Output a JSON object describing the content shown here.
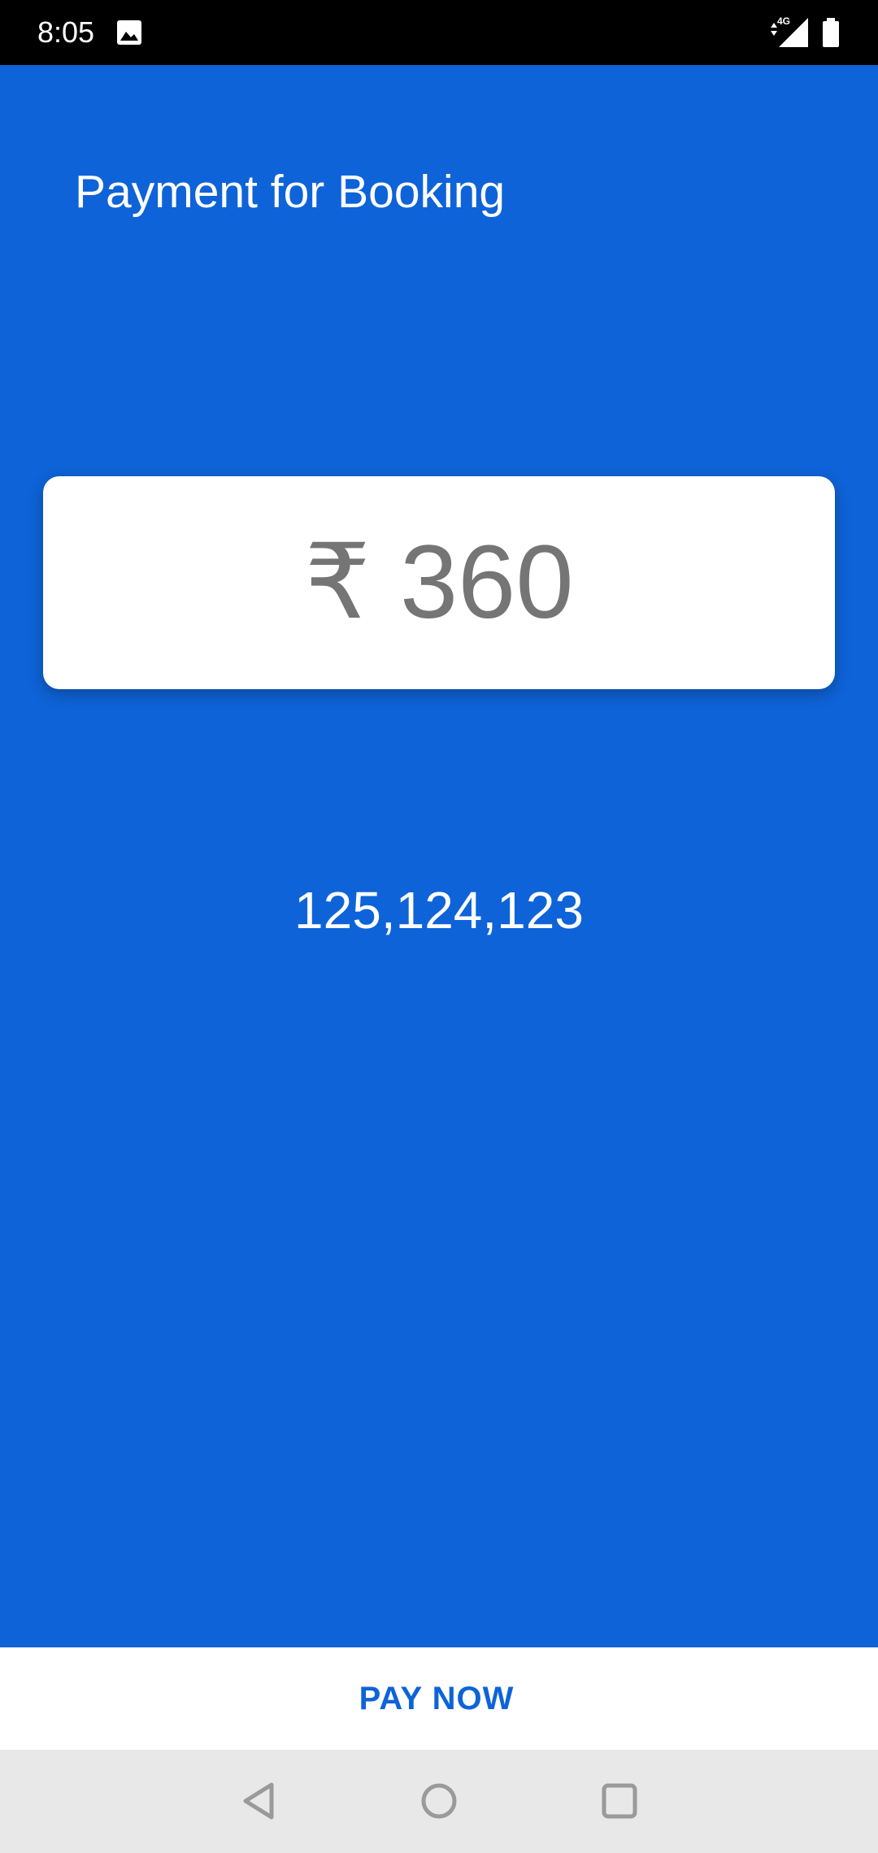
{
  "status_bar": {
    "time": "8:05",
    "network": "4G",
    "icons": [
      "image-icon",
      "signal-icon",
      "battery-icon"
    ]
  },
  "page": {
    "title": "Payment for Booking",
    "background_color": "#0E63D8"
  },
  "amount_card": {
    "currency_symbol": "₹",
    "amount": "360"
  },
  "booking": {
    "ids": "125,124,123"
  },
  "pay_button": {
    "label": "PAY NOW",
    "color": "#0E63D8"
  },
  "nav_bar": {
    "buttons": [
      "back-icon",
      "home-icon",
      "recents-icon"
    ]
  }
}
